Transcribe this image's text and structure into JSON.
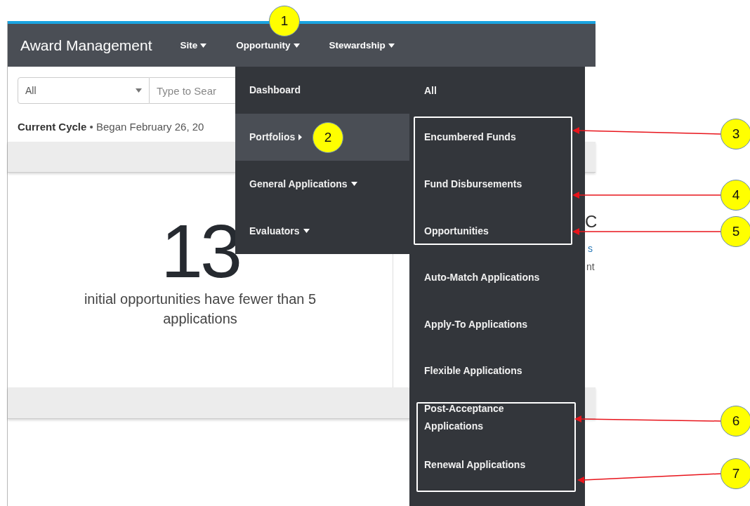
{
  "navbar": {
    "title": "Award Management",
    "items": [
      {
        "label": "Site"
      },
      {
        "label": "Opportunity"
      },
      {
        "label": "Stewardship"
      }
    ]
  },
  "filter": {
    "scope": "All",
    "placeholder": "Type to Sear"
  },
  "cycle": {
    "label": "Current Cycle",
    "detail": "• Began February 26, 20"
  },
  "stat": {
    "value": "13",
    "caption": "initial opportunities have fewer than 5 applications"
  },
  "right_panel": {
    "heading": "C",
    "line_1": "s",
    "line_2": "nt"
  },
  "menu": {
    "items": [
      {
        "label": "Dashboard",
        "kind": "link",
        "selected": false
      },
      {
        "label": "Portfolios",
        "kind": "flyout",
        "selected": true
      },
      {
        "label": "General Applications",
        "kind": "dropdown",
        "selected": false
      },
      {
        "label": "Evaluators",
        "kind": "dropdown",
        "selected": false
      }
    ]
  },
  "submenu": {
    "items": [
      {
        "label": "All"
      },
      {
        "label": "Encumbered Funds"
      },
      {
        "label": "Fund Disbursements"
      },
      {
        "label": "Opportunities"
      },
      {
        "label": "Auto-Match Applications"
      },
      {
        "label": "Apply-To Applications"
      },
      {
        "label": "Flexible Applications"
      },
      {
        "label": "Post-Acceptance Applications"
      },
      {
        "label": "Renewal Applications"
      }
    ]
  },
  "callouts": [
    {
      "number": "1"
    },
    {
      "number": "2"
    },
    {
      "number": "3"
    },
    {
      "number": "4"
    },
    {
      "number": "5"
    },
    {
      "number": "6"
    },
    {
      "number": "7"
    }
  ]
}
